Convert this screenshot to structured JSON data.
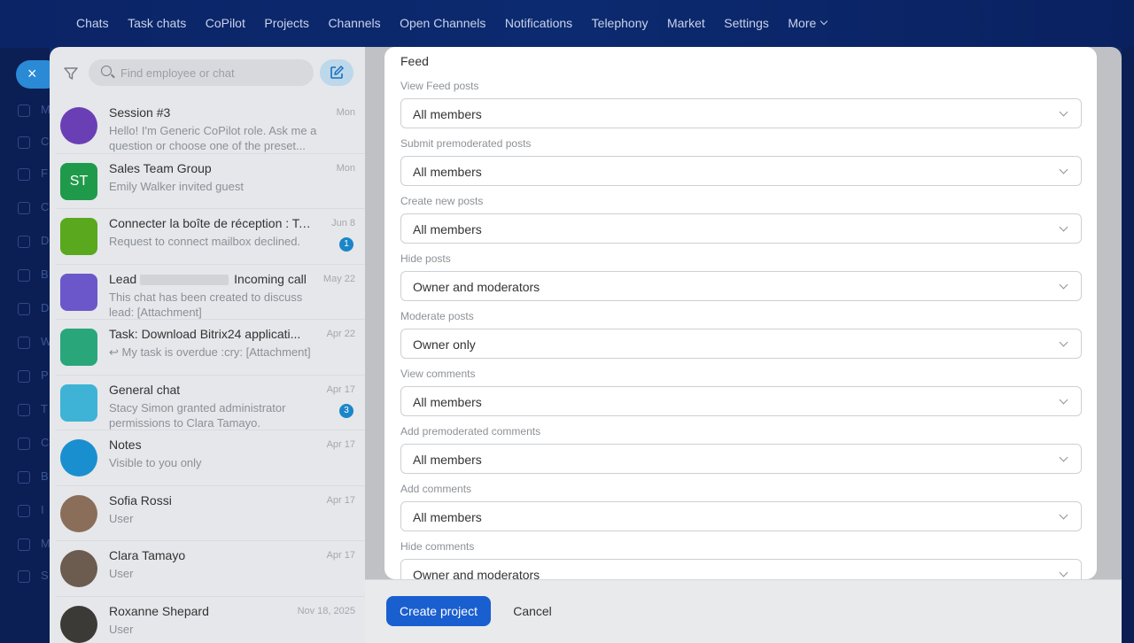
{
  "topnav": {
    "items": [
      "Chats",
      "Task chats",
      "CoPilot",
      "Projects",
      "Channels",
      "Open Channels",
      "Notifications",
      "Telephony",
      "Market",
      "Settings"
    ],
    "more_label": "More"
  },
  "sidebar": {
    "close_label": "×",
    "letters": [
      "M",
      "C",
      "F",
      "C",
      "D",
      "B",
      "D",
      "W",
      "P",
      "T",
      "C",
      "B",
      "I",
      "M",
      "S"
    ]
  },
  "search": {
    "placeholder": "Find employee or chat"
  },
  "chats": [
    {
      "title": "Session #3",
      "date": "Mon",
      "msg": "Hello! I'm Generic CoPilot role. Ask me a question or choose one of the preset...",
      "avatar_color": "#6a3fb5",
      "avatar_text": ""
    },
    {
      "title": "Sales Team Group",
      "date": "Mon",
      "msg": "Emily Walker invited guest",
      "avatar_color": "#1f9a4a",
      "avatar_text": "ST"
    },
    {
      "title": "Connecter la boîte de réception : To...",
      "date": "Jun 8",
      "msg": "Request to connect mailbox declined.",
      "avatar_color": "#59a81d",
      "avatar_text": "",
      "badge": "1"
    },
    {
      "title": "Lead",
      "title_suffix": "Incoming call",
      "date": "May 22",
      "msg": "This chat has been created to discuss lead: [Attachment]",
      "avatar_color": "#6b57c9",
      "avatar_text": ""
    },
    {
      "title": "Task: Download Bitrix24 applicati...",
      "date": "Apr 22",
      "msg": "↩ My task is overdue :cry: [Attachment]",
      "avatar_color": "#2aa67b",
      "avatar_text": ""
    },
    {
      "title": "General chat",
      "date": "Apr 17",
      "msg": "Stacy Simon granted administrator permissions to Clara Tamayo.",
      "avatar_color": "#3fb3d6",
      "avatar_text": "",
      "badge": "3"
    },
    {
      "title": "Notes",
      "date": "Apr 17",
      "msg": "Visible to you only",
      "avatar_color": "#1a8fd0",
      "avatar_text": ""
    },
    {
      "title": "Sofia Rossi",
      "date": "Apr 17",
      "msg": "User",
      "avatar_color": "#8a6e5a",
      "avatar_text": ""
    },
    {
      "title": "Clara Tamayo",
      "date": "Apr 17",
      "msg": "User",
      "avatar_color": "#6c5b4f",
      "avatar_text": ""
    },
    {
      "title": "Roxanne Shepard",
      "date": "Nov 18, 2025",
      "msg": "User",
      "avatar_color": "#3c3a36",
      "avatar_text": ""
    }
  ],
  "modal": {
    "section_title": "Feed",
    "fields": [
      {
        "label": "View Feed posts",
        "value": "All members"
      },
      {
        "label": "Submit premoderated posts",
        "value": "All members"
      },
      {
        "label": "Create new posts",
        "value": "All members"
      },
      {
        "label": "Hide posts",
        "value": "Owner and moderators"
      },
      {
        "label": "Moderate posts",
        "value": "Owner only"
      },
      {
        "label": "View comments",
        "value": "All members"
      },
      {
        "label": "Add premoderated comments",
        "value": "All members"
      },
      {
        "label": "Add comments",
        "value": "All members"
      },
      {
        "label": "Hide comments",
        "value": "Owner and moderators"
      }
    ]
  },
  "footer": {
    "create_label": "Create project",
    "cancel_label": "Cancel"
  }
}
